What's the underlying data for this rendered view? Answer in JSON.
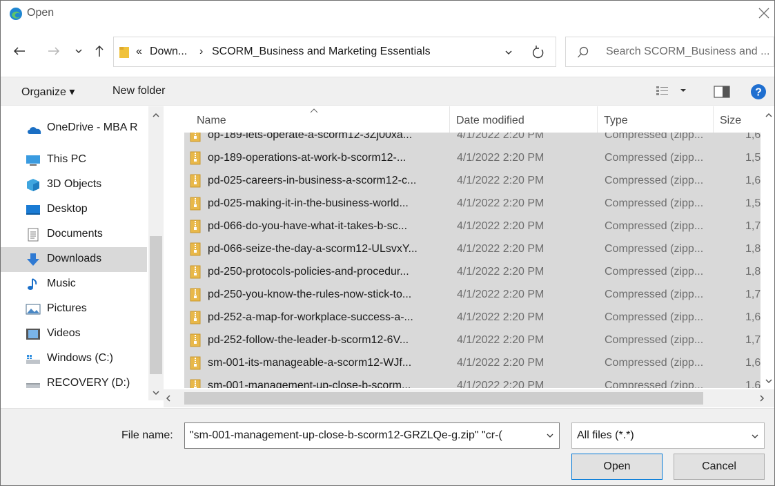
{
  "window": {
    "title": "Open"
  },
  "address": {
    "crumbs": [
      "«",
      "Down...",
      "›",
      "SCORM_Business and Marketing Essentials"
    ],
    "search_placeholder": "Search SCORM_Business and ..."
  },
  "toolbar": {
    "organize": "Organize ▾",
    "new_folder": "New folder"
  },
  "nav": {
    "items": [
      {
        "label": "OneDrive - MBA R",
        "icon": "cloud-icon"
      },
      {
        "label": "This PC",
        "icon": "computer-icon"
      },
      {
        "label": "3D Objects",
        "icon": "cube-icon"
      },
      {
        "label": "Desktop",
        "icon": "desktop-icon"
      },
      {
        "label": "Documents",
        "icon": "document-icon"
      },
      {
        "label": "Downloads",
        "icon": "download-icon",
        "selected": true
      },
      {
        "label": "Music",
        "icon": "music-icon"
      },
      {
        "label": "Pictures",
        "icon": "picture-icon"
      },
      {
        "label": "Videos",
        "icon": "video-icon"
      },
      {
        "label": "Windows (C:)",
        "icon": "drive-icon"
      },
      {
        "label": "RECOVERY (D:)",
        "icon": "drive-icon"
      }
    ]
  },
  "columns": {
    "name": "Name",
    "date": "Date modified",
    "type": "Type",
    "size": "Size"
  },
  "files": [
    {
      "name": "op-189-lets-operate-a-scorm12-3Zj00xa...",
      "date": "4/1/2022 2:20 PM",
      "type": "Compressed (zipp...",
      "size": "1,6"
    },
    {
      "name": "op-189-operations-at-work-b-scorm12-...",
      "date": "4/1/2022 2:20 PM",
      "type": "Compressed (zipp...",
      "size": "1,5"
    },
    {
      "name": "pd-025-careers-in-business-a-scorm12-c...",
      "date": "4/1/2022 2:20 PM",
      "type": "Compressed (zipp...",
      "size": "1,6"
    },
    {
      "name": "pd-025-making-it-in-the-business-world...",
      "date": "4/1/2022 2:20 PM",
      "type": "Compressed (zipp...",
      "size": "1,5"
    },
    {
      "name": "pd-066-do-you-have-what-it-takes-b-sc...",
      "date": "4/1/2022 2:20 PM",
      "type": "Compressed (zipp...",
      "size": "1,7"
    },
    {
      "name": "pd-066-seize-the-day-a-scorm12-ULsvxY...",
      "date": "4/1/2022 2:20 PM",
      "type": "Compressed (zipp...",
      "size": "1,8"
    },
    {
      "name": "pd-250-protocols-policies-and-procedur...",
      "date": "4/1/2022 2:20 PM",
      "type": "Compressed (zipp...",
      "size": "1,8"
    },
    {
      "name": "pd-250-you-know-the-rules-now-stick-to...",
      "date": "4/1/2022 2:20 PM",
      "type": "Compressed (zipp...",
      "size": "1,7"
    },
    {
      "name": "pd-252-a-map-for-workplace-success-a-...",
      "date": "4/1/2022 2:20 PM",
      "type": "Compressed (zipp...",
      "size": "1,6"
    },
    {
      "name": "pd-252-follow-the-leader-b-scorm12-6V...",
      "date": "4/1/2022 2:20 PM",
      "type": "Compressed (zipp...",
      "size": "1,7"
    },
    {
      "name": "sm-001-its-manageable-a-scorm12-WJf...",
      "date": "4/1/2022 2:20 PM",
      "type": "Compressed (zipp...",
      "size": "1,6"
    },
    {
      "name": "sm-001-management-up-close-b-scorm...",
      "date": "4/1/2022 2:20 PM",
      "type": "Compressed (zipp...",
      "size": "1,6"
    }
  ],
  "footer": {
    "file_name_label": "File name:",
    "file_name_value": "\"sm-001-management-up-close-b-scorm12-GRZLQe-g.zip\" \"cr-(",
    "file_type": "All files (*.*)",
    "open_label": "Open",
    "cancel_label": "Cancel"
  },
  "colors": {
    "accent": "#0078d7",
    "selection": "#d9d9d9",
    "chrome": "#f0f0f0",
    "zip_yellow": "#e8b84a"
  }
}
